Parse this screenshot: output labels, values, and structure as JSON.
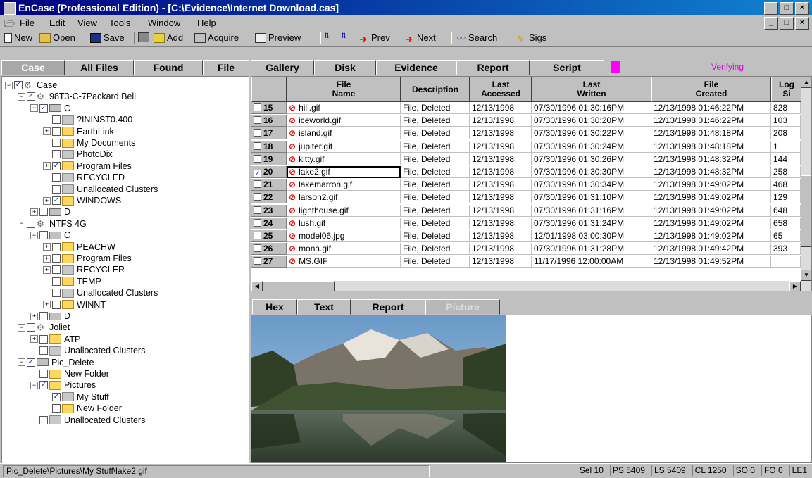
{
  "window": {
    "title": "EnCase (Professional Edition) - [C:\\Evidence\\Internet Download.cas]",
    "min": "_",
    "max": "□",
    "close": "×"
  },
  "menu": [
    "File",
    "Edit",
    "View",
    "Tools",
    "Window",
    "Help"
  ],
  "toolbar": [
    {
      "label": "New",
      "icon": "new-doc-icon"
    },
    {
      "label": "Open",
      "icon": "open-folder-icon"
    },
    {
      "label": "Save",
      "icon": "save-disk-icon"
    },
    {
      "label": "",
      "icon": "print-icon"
    },
    {
      "label": "Add",
      "icon": "add-icon"
    },
    {
      "label": "Acquire",
      "icon": "acquire-icon"
    },
    {
      "label": "Preview",
      "icon": "preview-icon"
    },
    {
      "label": "",
      "icon": "sort-asc-icon"
    },
    {
      "label": "",
      "icon": "sort-desc-icon"
    },
    {
      "label": "Prev",
      "icon": "prev-arrow-icon"
    },
    {
      "label": "Next",
      "icon": "next-arrow-icon"
    },
    {
      "label": "Search",
      "icon": "binoculars-icon"
    },
    {
      "label": "Sigs",
      "icon": "sigs-icon"
    }
  ],
  "tabs": [
    "Case",
    "All Files",
    "Found",
    "File",
    "Gallery",
    "Disk",
    "Evidence",
    "Report",
    "Script"
  ],
  "status_verifying": "Verifying",
  "tree": [
    {
      "label": "Case",
      "depth": 0,
      "exp": "−",
      "checked": true,
      "type": "case"
    },
    {
      "label": "98T3-C-7Packard Bell",
      "depth": 1,
      "exp": "−",
      "checked": true,
      "type": "vol"
    },
    {
      "label": "C",
      "depth": 2,
      "exp": "−",
      "checked": true,
      "type": "drv"
    },
    {
      "label": "?ININST0.400",
      "depth": 3,
      "exp": "",
      "checked": false,
      "type": "gray"
    },
    {
      "label": "EarthLink",
      "depth": 3,
      "exp": "+",
      "checked": false,
      "type": "fld"
    },
    {
      "label": "My Documents",
      "depth": 3,
      "exp": "",
      "checked": false,
      "type": "fld"
    },
    {
      "label": "PhotoDix",
      "depth": 3,
      "exp": "",
      "checked": false,
      "type": "gray"
    },
    {
      "label": "Program Files",
      "depth": 3,
      "exp": "+",
      "checked": true,
      "type": "fld"
    },
    {
      "label": "RECYCLED",
      "depth": 3,
      "exp": "",
      "checked": false,
      "type": "gray"
    },
    {
      "label": "Unallocated Clusters",
      "depth": 3,
      "exp": "",
      "checked": false,
      "type": "gray"
    },
    {
      "label": "WINDOWS",
      "depth": 3,
      "exp": "+",
      "checked": true,
      "type": "fld"
    },
    {
      "label": "D",
      "depth": 2,
      "exp": "+",
      "checked": false,
      "type": "drv"
    },
    {
      "label": "NTFS 4G",
      "depth": 1,
      "exp": "−",
      "checked": false,
      "type": "vol"
    },
    {
      "label": "C",
      "depth": 2,
      "exp": "−",
      "checked": false,
      "type": "drv"
    },
    {
      "label": "PEACHW",
      "depth": 3,
      "exp": "+",
      "checked": false,
      "type": "fld"
    },
    {
      "label": "Program Files",
      "depth": 3,
      "exp": "+",
      "checked": false,
      "type": "fld"
    },
    {
      "label": "RECYCLER",
      "depth": 3,
      "exp": "+",
      "checked": false,
      "type": "gray"
    },
    {
      "label": "TEMP",
      "depth": 3,
      "exp": "",
      "checked": false,
      "type": "fld"
    },
    {
      "label": "Unallocated Clusters",
      "depth": 3,
      "exp": "",
      "checked": false,
      "type": "gray"
    },
    {
      "label": "WINNT",
      "depth": 3,
      "exp": "+",
      "checked": false,
      "type": "fld"
    },
    {
      "label": "D",
      "depth": 2,
      "exp": "+",
      "checked": false,
      "type": "drv"
    },
    {
      "label": "Joliet",
      "depth": 1,
      "exp": "−",
      "checked": false,
      "type": "vol"
    },
    {
      "label": "ATP",
      "depth": 2,
      "exp": "+",
      "checked": false,
      "type": "fld"
    },
    {
      "label": "Unallocated Clusters",
      "depth": 2,
      "exp": "",
      "checked": false,
      "type": "gray"
    },
    {
      "label": "Pic_Delete",
      "depth": 1,
      "exp": "−",
      "checked": true,
      "type": "drv"
    },
    {
      "label": "New Folder",
      "depth": 2,
      "exp": "",
      "checked": false,
      "type": "fld"
    },
    {
      "label": "Pictures",
      "depth": 2,
      "exp": "−",
      "checked": true,
      "type": "fld"
    },
    {
      "label": "My Stuff",
      "depth": 3,
      "exp": "",
      "checked": true,
      "type": "gray"
    },
    {
      "label": "New Folder",
      "depth": 3,
      "exp": "",
      "checked": false,
      "type": "fld"
    },
    {
      "label": "Unallocated Clusters",
      "depth": 2,
      "exp": "",
      "checked": false,
      "type": "gray"
    }
  ],
  "grid": {
    "columns": [
      "",
      "File\nName",
      "Description",
      "Last\nAccessed",
      "Last\nWritten",
      "File\nCreated",
      "Log\nSi"
    ],
    "rows": [
      {
        "n": "15",
        "name": "hill.gif",
        "desc": "File, Deleted",
        "acc": "12/13/1998",
        "wr": "07/30/1996 01:30:16PM",
        "cr": "12/13/1998 01:46:22PM",
        "size": "828",
        "checked": false
      },
      {
        "n": "16",
        "name": "iceworld.gif",
        "desc": "File, Deleted",
        "acc": "12/13/1998",
        "wr": "07/30/1996 01:30:20PM",
        "cr": "12/13/1998 01:46:22PM",
        "size": "103",
        "checked": false
      },
      {
        "n": "17",
        "name": "island.gif",
        "desc": "File, Deleted",
        "acc": "12/13/1998",
        "wr": "07/30/1996 01:30:22PM",
        "cr": "12/13/1998 01:48:18PM",
        "size": "208",
        "checked": false
      },
      {
        "n": "18",
        "name": "jupiter.gif",
        "desc": "File, Deleted",
        "acc": "12/13/1998",
        "wr": "07/30/1996 01:30:24PM",
        "cr": "12/13/1998 01:48:18PM",
        "size": "1",
        "checked": false
      },
      {
        "n": "19",
        "name": "kitty.gif",
        "desc": "File, Deleted",
        "acc": "12/13/1998",
        "wr": "07/30/1996 01:30:26PM",
        "cr": "12/13/1998 01:48:32PM",
        "size": "144",
        "checked": false
      },
      {
        "n": "20",
        "name": "lake2.gif",
        "desc": "File, Deleted",
        "acc": "12/13/1998",
        "wr": "07/30/1996 01:30:30PM",
        "cr": "12/13/1998 01:48:32PM",
        "size": "258",
        "checked": true
      },
      {
        "n": "21",
        "name": "lakemarron.gif",
        "desc": "File, Deleted",
        "acc": "12/13/1998",
        "wr": "07/30/1996 01:30:34PM",
        "cr": "12/13/1998 01:49:02PM",
        "size": "468",
        "checked": false
      },
      {
        "n": "22",
        "name": "larson2.gif",
        "desc": "File, Deleted",
        "acc": "12/13/1998",
        "wr": "07/30/1996 01:31:10PM",
        "cr": "12/13/1998 01:49:02PM",
        "size": "129",
        "checked": false
      },
      {
        "n": "23",
        "name": "lighthouse.gif",
        "desc": "File, Deleted",
        "acc": "12/13/1998",
        "wr": "07/30/1996 01:31:16PM",
        "cr": "12/13/1998 01:49:02PM",
        "size": "648",
        "checked": false
      },
      {
        "n": "24",
        "name": "lush.gif",
        "desc": "File, Deleted",
        "acc": "12/13/1998",
        "wr": "07/30/1996 01:31:24PM",
        "cr": "12/13/1998 01:49:02PM",
        "size": "658",
        "checked": false
      },
      {
        "n": "25",
        "name": "model06.jpg",
        "desc": "File, Deleted",
        "acc": "12/13/1998",
        "wr": "12/01/1998 03:00:30PM",
        "cr": "12/13/1998 01:49:02PM",
        "size": "65",
        "checked": false
      },
      {
        "n": "26",
        "name": "mona.gif",
        "desc": "File, Deleted",
        "acc": "12/13/1998",
        "wr": "07/30/1996 01:31:28PM",
        "cr": "12/13/1998 01:49:42PM",
        "size": "393",
        "checked": false
      },
      {
        "n": "27",
        "name": "MS.GIF",
        "desc": "File, Deleted",
        "acc": "12/13/1998",
        "wr": "11/17/1996 12:00:00AM",
        "cr": "12/13/1998 01:49:52PM",
        "size": "",
        "checked": false
      }
    ]
  },
  "bottom_tabs": [
    "Hex",
    "Text",
    "Report",
    "Picture"
  ],
  "statusbar": {
    "path": "Pic_Delete\\Pictures\\My Stuff\\lake2.gif",
    "fields": [
      "Sel 10",
      "PS 5409",
      "LS 5409",
      "CL 1250",
      "SO 0",
      "FO 0",
      "LE1"
    ]
  }
}
